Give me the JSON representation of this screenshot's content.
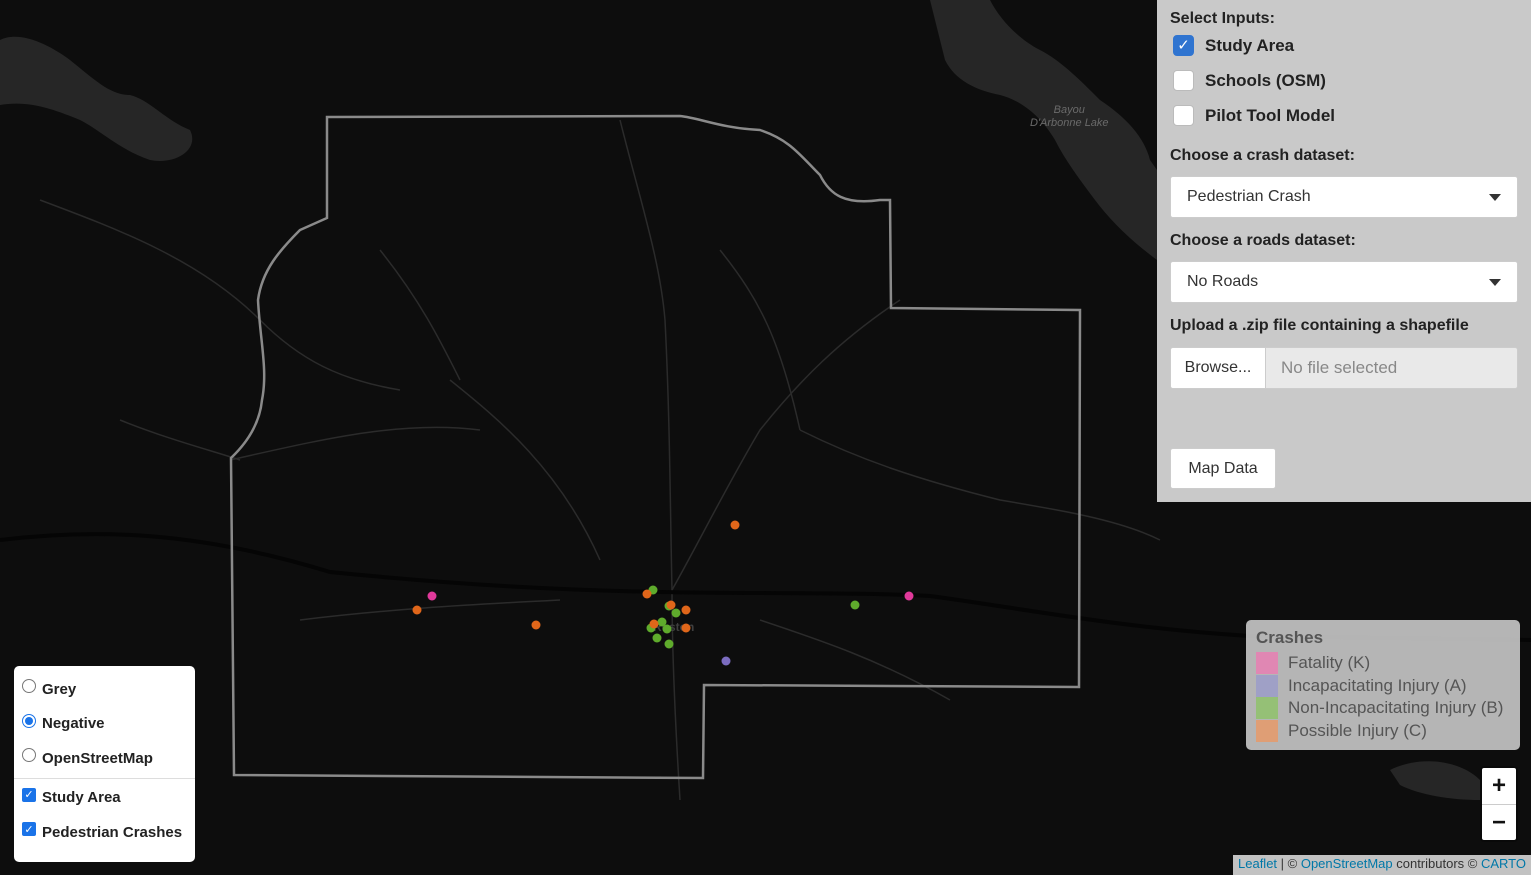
{
  "panel": {
    "select_inputs_label": "Select Inputs:",
    "inputs": [
      {
        "label": "Study Area",
        "checked": true
      },
      {
        "label": "Schools (OSM)",
        "checked": false
      },
      {
        "label": "Pilot Tool Model",
        "checked": false
      }
    ],
    "crash_dataset_label": "Choose a crash dataset:",
    "crash_dataset_value": "Pedestrian Crash",
    "roads_dataset_label": "Choose a roads dataset:",
    "roads_dataset_value": "No Roads",
    "upload_label": "Upload a .zip file containing a shapefile",
    "browse_label": "Browse...",
    "file_placeholder": "No file selected",
    "map_button_label": "Map Data"
  },
  "legend": {
    "title": "Crashes",
    "items": [
      {
        "label": "Fatality (K)",
        "color": "#e77fb3"
      },
      {
        "label": "Incapacitating Injury (A)",
        "color": "#9b9cc9"
      },
      {
        "label": "Non-Incapacitating Injury (B)",
        "color": "#8fc26b"
      },
      {
        "label": "Possible Injury (C)",
        "color": "#e69a6a"
      }
    ]
  },
  "layers": {
    "basemaps": [
      {
        "label": "Grey",
        "selected": false
      },
      {
        "label": "Negative",
        "selected": true
      },
      {
        "label": "OpenStreetMap",
        "selected": false
      }
    ],
    "overlays": [
      {
        "label": "Study Area",
        "checked": true
      },
      {
        "label": "Pedestrian Crashes",
        "checked": true
      }
    ]
  },
  "zoom": {
    "in_label": "+",
    "out_label": "−"
  },
  "attribution": {
    "leaflet": "Leaflet",
    "sep": " | © ",
    "osm": "OpenStreetMap",
    "contributors": " contributors © ",
    "carto": "CARTO"
  },
  "map_labels": {
    "lake_line1": "Bayou",
    "lake_line2": "D'Arbonne Lake",
    "city": "Ruston"
  },
  "marker_colors": {
    "fatality": "#e0399a",
    "incapacitating": "#7b6cc0",
    "non_incapacitating": "#5fab2c",
    "possible": "#e0661a"
  }
}
